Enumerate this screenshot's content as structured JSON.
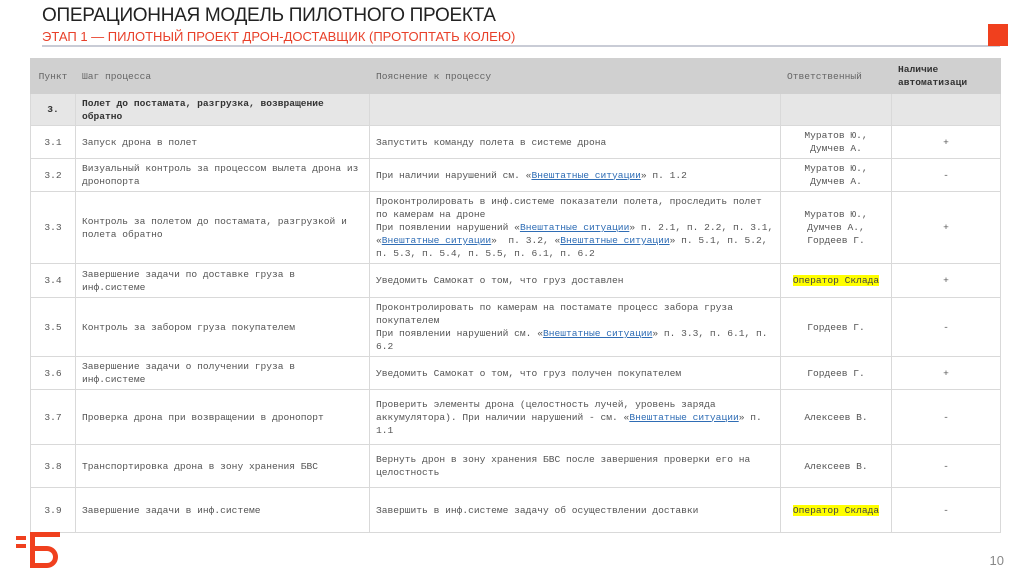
{
  "header": {
    "title": "ОПЕРАЦИОННАЯ МОДЕЛЬ ПИЛОТНОГО ПРОЕКТА",
    "subtitle": "ЭТАП 1 — ПИЛОТНЫЙ ПРОЕКТ ДРОН-ДОСТАВЩИК (ПРОТОПТАТЬ КОЛЕЮ)"
  },
  "table": {
    "columns": [
      "Пункт",
      "Шаг процесса",
      "Пояснение к процессу",
      "Ответственный",
      "Наличие автоматизаци"
    ],
    "section": {
      "num": "3.",
      "step": "Полет до постамата, разгрузка, возвращение обратно"
    },
    "rows": [
      {
        "num": "3.1",
        "step": "Запуск дрона в полет",
        "expl": [
          {
            "t": "Запустить команду полета в системе дрона"
          }
        ],
        "resp": "Муратов Ю., Думчев А.",
        "hl": false,
        "auto": "+"
      },
      {
        "num": "3.2",
        "step": "Визуальный контроль за процессом вылета дрона из дронопорта",
        "expl": [
          {
            "t": "При наличии нарушений см. «"
          },
          {
            "t": "Внештатные ситуации",
            "link": true
          },
          {
            "t": "» п. 1.2"
          }
        ],
        "resp": "Муратов Ю., Думчев А.",
        "hl": false,
        "auto": "-"
      },
      {
        "num": "3.3",
        "step": "Контроль за полетом до постамата, разгрузкой и полета обратно",
        "expl": [
          {
            "t": "Проконтролировать в инф.системе показатели полета, проследить полет по камерам на дроне\nПри появлении нарушений «"
          },
          {
            "t": "Внештатные ситуации",
            "link": true
          },
          {
            "t": "» п. 2.1, п. 2.2, п. 3.1, «"
          },
          {
            "t": "Внештатные ситуации",
            "link": true
          },
          {
            "t": "»  п. 3.2, «"
          },
          {
            "t": "Внештатные ситуации",
            "link": true
          },
          {
            "t": "» п. 5.1, п. 5.2, п. 5.3, п. 5.4, п. 5.5, п. 6.1, п. 6.2"
          }
        ],
        "resp": "Муратов Ю., Думчев А., Гордеев Г.",
        "hl": false,
        "auto": "+"
      },
      {
        "num": "3.4",
        "step": "Завершение задачи по доставке груза в инф.системе",
        "expl": [
          {
            "t": "Уведомить Самокат о том, что груз доставлен"
          }
        ],
        "resp": "Оператор Склада",
        "hl": true,
        "auto": "+"
      },
      {
        "num": "3.5",
        "step": "Контроль за забором груза покупателем",
        "expl": [
          {
            "t": "Проконтролировать по камерам на постамате процесс забора груза покупателем\nПри появлении нарушений см. «"
          },
          {
            "t": "Внештатные ситуации",
            "link": true
          },
          {
            "t": "» п. 3.3, п. 6.1, п. 6.2"
          }
        ],
        "resp": "Гордеев Г.",
        "hl": false,
        "auto": "-"
      },
      {
        "num": "3.6",
        "step": "Завершение задачи о получении груза в инф.системе",
        "expl": [
          {
            "t": "Уведомить Самокат о том, что груз получен покупателем"
          }
        ],
        "resp": "Гордеев Г.",
        "hl": false,
        "auto": "+"
      },
      {
        "num": "3.7",
        "step": "Проверка дрона при возвращении в дронопорт",
        "expl": [
          {
            "t": "Проверить элементы дрона (целостность лучей, уровень заряда аккумулятора). При наличии нарушений - см. «"
          },
          {
            "t": "Внештатные ситуации",
            "link": true
          },
          {
            "t": "» п. 1.1"
          }
        ],
        "resp": "Алексеев В.",
        "hl": false,
        "auto": "-"
      },
      {
        "num": "3.8",
        "step": "Транспортировка дрона в зону хранения БВС",
        "expl": [
          {
            "t": "Вернуть дрон в зону хранения БВС после завершения проверки его на целостность"
          }
        ],
        "resp": "Алексеев В.",
        "hl": false,
        "auto": "-"
      },
      {
        "num": "3.9",
        "step": "Завершение задачи в инф.системе",
        "expl": [
          {
            "t": "Завершить в инф.системе задачу об осуществлении доставки"
          }
        ],
        "resp": "Оператор Склада",
        "hl": true,
        "auto": "-"
      }
    ]
  },
  "footer": {
    "page": "10"
  },
  "colors": {
    "accent": "#f0401e",
    "link": "#2f6db5",
    "highlight": "#ffff00"
  }
}
